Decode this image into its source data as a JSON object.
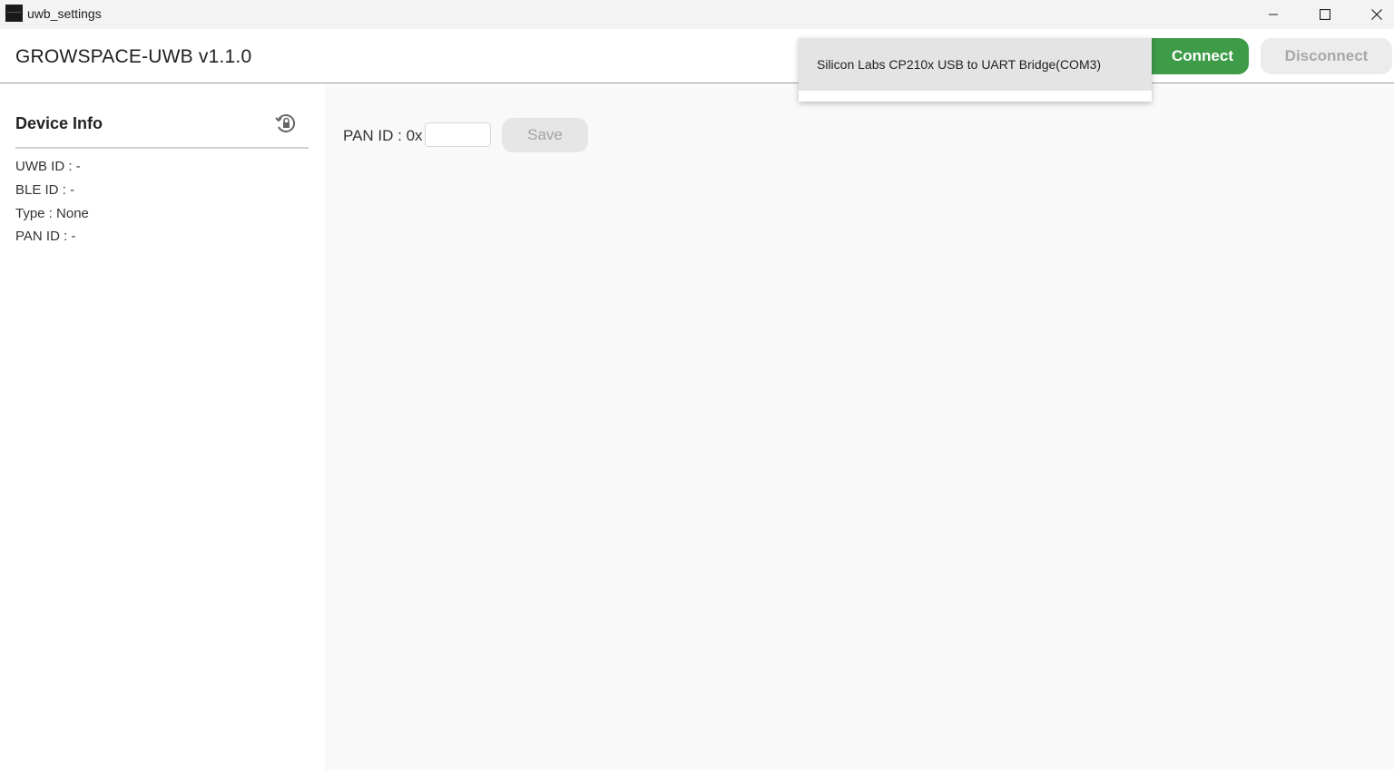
{
  "window": {
    "title": "uwb_settings",
    "controls": {
      "minimize_icon": "minimize-icon",
      "maximize_icon": "maximize-icon",
      "close_icon": "close-icon"
    }
  },
  "header": {
    "title": "GROWSPACE-UWB v1.1.0",
    "connect_label": "Connect",
    "disconnect_label": "Disconnect",
    "connect_color": "#3e9b48"
  },
  "port_dropdown": {
    "options": [
      {
        "label": "Silicon Labs CP210x USB to UART Bridge(COM3)"
      }
    ]
  },
  "sidebar": {
    "title": "Device Info",
    "refresh_icon": "refresh-lock-icon",
    "rows": [
      {
        "text": "UWB ID : -"
      },
      {
        "text": "BLE ID : -"
      },
      {
        "text": "Type : None"
      },
      {
        "text": "PAN ID : -"
      }
    ]
  },
  "main": {
    "pan_label": "PAN ID : 0x",
    "pan_value": "",
    "pan_placeholder": "",
    "save_label": "Save"
  }
}
